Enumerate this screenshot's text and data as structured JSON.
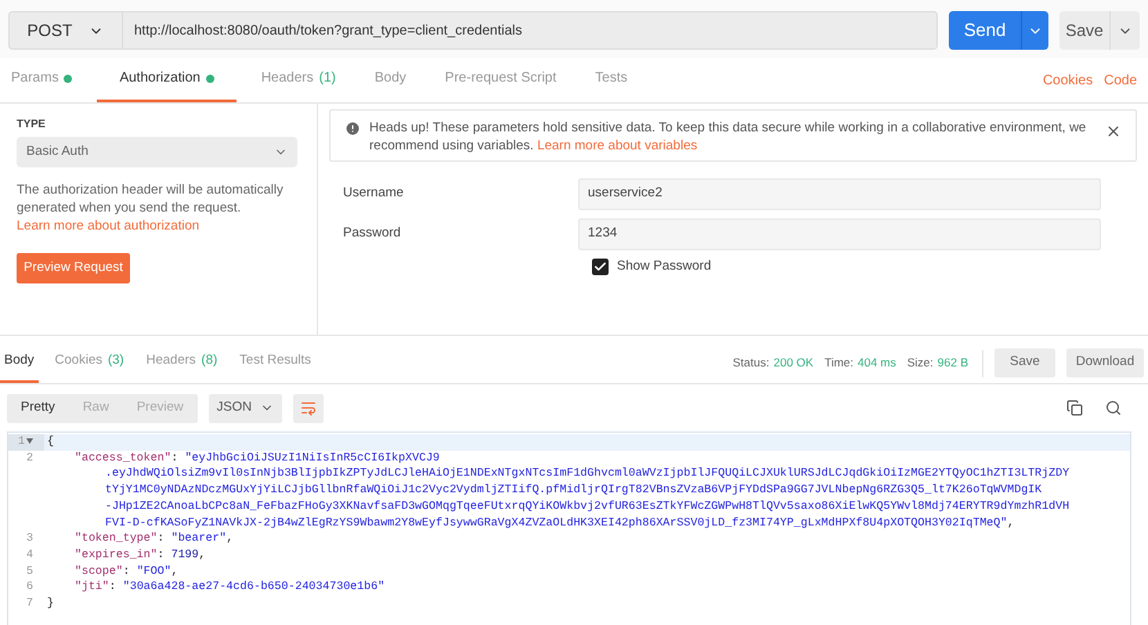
{
  "request": {
    "method": "POST",
    "url": "http://localhost:8080/oauth/token?grant_type=client_credentials",
    "send": "Send",
    "save": "Save"
  },
  "request_tabs": [
    {
      "label": "Params",
      "dot": true,
      "selected": false
    },
    {
      "label": "Authorization",
      "dot": true,
      "selected": true
    },
    {
      "label": "Headers",
      "count": "(1)",
      "selected": false
    },
    {
      "label": "Body",
      "selected": false
    },
    {
      "label": "Pre-request Script",
      "selected": false
    },
    {
      "label": "Tests",
      "selected": false
    }
  ],
  "request_links": [
    "Cookies",
    "Code"
  ],
  "auth": {
    "type_label": "TYPE",
    "type": "Basic Auth",
    "description": "The authorization header will be automatically generated when you send the request.",
    "description_link": "Learn more about authorization",
    "preview_button": "Preview Request",
    "alert": {
      "text": "Heads up! These parameters hold sensitive data. To keep this data secure while working in a collaborative environment, we recommend using variables.",
      "link": "Learn more about variables"
    },
    "fields": [
      {
        "label": "Username",
        "value": "userservice2"
      },
      {
        "label": "Password",
        "value": "1234"
      }
    ],
    "show_password": {
      "label": "Show Password",
      "checked": true
    }
  },
  "response_tabs": [
    {
      "label": "Body",
      "selected": true
    },
    {
      "label": "Cookies",
      "count": "(3)",
      "selected": false
    },
    {
      "label": "Headers",
      "count": "(8)",
      "selected": false
    },
    {
      "label": "Test Results",
      "selected": false
    }
  ],
  "response_stats": [
    {
      "label": "Status:",
      "value": "200 OK"
    },
    {
      "label": "Time:",
      "value": "404 ms"
    },
    {
      "label": "Size:",
      "value": "962 B"
    }
  ],
  "response_buttons": [
    "Save",
    "Download"
  ],
  "view_modes": [
    {
      "label": "Pretty",
      "selected": true
    },
    {
      "label": "Raw",
      "selected": false
    },
    {
      "label": "Preview",
      "selected": false
    }
  ],
  "format": "JSON",
  "code_lines": [
    {
      "number": "1",
      "foldable": true,
      "tokens": [
        {
          "kind": "punct",
          "text": "{"
        }
      ]
    },
    {
      "number": "2",
      "tokens": [
        {
          "kind": "key",
          "text": "\"access_token\""
        },
        {
          "kind": "punct",
          "text": ": "
        },
        {
          "kind": "string",
          "text": "\"eyJhbGciOiJSUzI1NiIsInR5cCI6IkpXVCJ9"
        }
      ],
      "wraps": [
        [
          {
            "kind": "string",
            "text": ".eyJhdWQiOlsiZm9vIl0sInNjb3BlIjpbIkZPTyJdLCJleHAiOjE1NDExNTgxNTcsImF1dGhvcml0aWVzIjpbIlJFQUQiLCJXUklURSJdLCJqdGkiOiIzMGE2YTQyOC1hZTI3LTRjZDY"
          }
        ],
        [
          {
            "kind": "string",
            "text": "tYjY1MC0yNDAzNDczMGUxYjYiLCJjbGllbnRfaWQiOiJ1c2Vyc2VydmljZTIifQ.pfMidljrQIrgT82VBnsZVzaB6VPjFYDdSPa9GG7JVLNbepNg6RZG3Q5_lt7K26oTqWVMDgIK"
          }
        ],
        [
          {
            "kind": "string",
            "text": "-JHp1ZE2CAnoaLbCPc8aN_FeFbazFHoGy3XKNavfsaFD3wGOMqgTqeeFUtxrqQYiKOWkbvj2vfUR63EsZTkYFWcZGWPwH8TlQVv5saxo86XiElwKQ5YWvl8Mdj74ERYTR9dYmzhR1dVH"
          }
        ],
        [
          {
            "kind": "string",
            "text": "FVI-D-cfKASoFyZ1NAVkJX-2jB4wZlEgRzYS9Wbawm2Y8wEyfJsywwGRaVgX4ZVZaOLdHK3XEI42ph86XArSSV0jLD_fz3MI74YP_gLxMdHPXf8U4pXOTQOH3Y02IqTMeQ\""
          },
          {
            "kind": "punct",
            "text": ","
          }
        ]
      ]
    },
    {
      "number": "3",
      "tokens": [
        {
          "kind": "key",
          "text": "\"token_type\""
        },
        {
          "kind": "punct",
          "text": ": "
        },
        {
          "kind": "string",
          "text": "\"bearer\""
        },
        {
          "kind": "punct",
          "text": ","
        }
      ]
    },
    {
      "number": "4",
      "tokens": [
        {
          "kind": "key",
          "text": "\"expires_in\""
        },
        {
          "kind": "punct",
          "text": ": "
        },
        {
          "kind": "number",
          "text": "7199"
        },
        {
          "kind": "punct",
          "text": ","
        }
      ]
    },
    {
      "number": "5",
      "tokens": [
        {
          "kind": "key",
          "text": "\"scope\""
        },
        {
          "kind": "punct",
          "text": ": "
        },
        {
          "kind": "string",
          "text": "\"FOO\""
        },
        {
          "kind": "punct",
          "text": ","
        }
      ]
    },
    {
      "number": "6",
      "tokens": [
        {
          "kind": "key",
          "text": "\"jti\""
        },
        {
          "kind": "punct",
          "text": ": "
        },
        {
          "kind": "string",
          "text": "\"30a6a428-ae27-4cd6-b650-24034730e1b6\""
        }
      ]
    },
    {
      "number": "7",
      "tokens": [
        {
          "kind": "punct",
          "text": "}"
        }
      ]
    }
  ]
}
